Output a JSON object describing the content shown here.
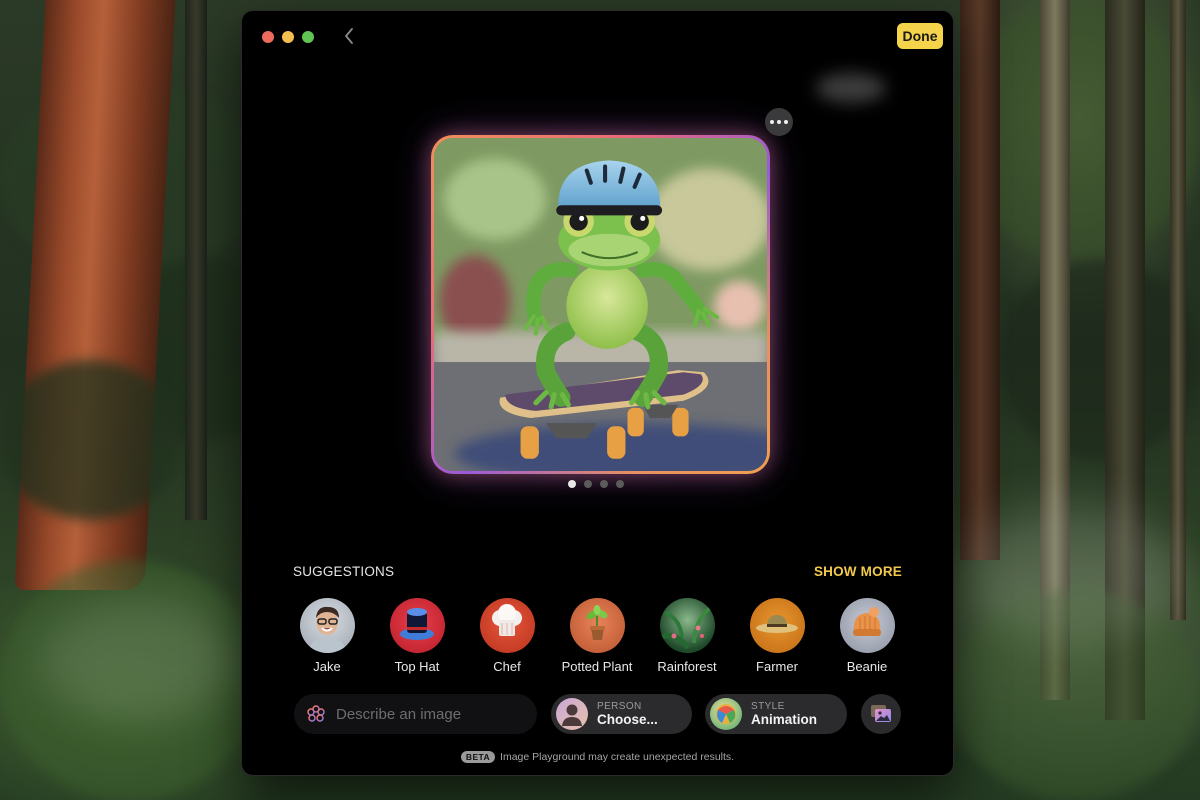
{
  "window": {
    "traffic_lights": [
      "close",
      "minimize",
      "zoom"
    ],
    "back_icon": "chevron-left-icon",
    "done_label": "Done",
    "more_icon": "ellipsis-icon"
  },
  "generated_image": {
    "description": "3D animated green frog wearing a light blue helmet, crouching on a skateboard on a street",
    "page_index": 1,
    "page_count": 4
  },
  "suggestions": {
    "title": "SUGGESTIONS",
    "show_more_label": "SHOW MORE",
    "items": [
      {
        "label": "Jake",
        "kind": "person"
      },
      {
        "label": "Top Hat",
        "kind": "accessory"
      },
      {
        "label": "Chef",
        "kind": "costume"
      },
      {
        "label": "Potted Plant",
        "kind": "object"
      },
      {
        "label": "Rainforest",
        "kind": "place"
      },
      {
        "label": "Farmer",
        "kind": "costume"
      },
      {
        "label": "Beanie",
        "kind": "accessory"
      }
    ]
  },
  "prompt": {
    "placeholder": "Describe an image",
    "value": "",
    "icon": "image-playground-icon"
  },
  "person_picker": {
    "caption": "PERSON",
    "value": "Choose..."
  },
  "style_picker": {
    "caption": "STYLE",
    "value": "Animation"
  },
  "photo_button": {
    "icon": "photo-library-icon"
  },
  "footer": {
    "badge": "BETA",
    "text": "Image Playground may create unexpected results."
  },
  "colors": {
    "accent_yellow": "#f5d34a",
    "show_more": "#f2c94c",
    "window_bg": "#000000",
    "pill_bg": "#2b2b2d"
  }
}
